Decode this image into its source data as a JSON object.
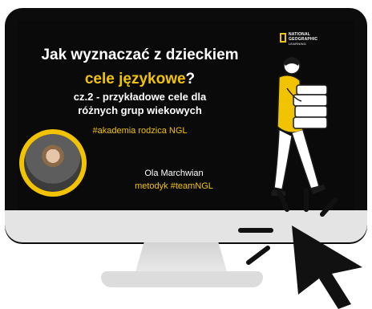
{
  "slide": {
    "title_line1": "Jak wyznaczać z dzieckiem",
    "title_line2_highlight": "cele językowe",
    "title_line2_tail": "?",
    "subtitle_line1": "cz.2 - przykładowe cele dla",
    "subtitle_line2": "różnych grup wiekowych",
    "hashtag": "#akademia rodzica NGL",
    "presenter_name": "Ola Marchwian",
    "presenter_role": "metodyk #teamNGL"
  },
  "logo": {
    "line1": "NATIONAL",
    "line2": "GEOGRAPHIC",
    "line3": "LEARNING"
  },
  "colors": {
    "accent": "#f2c300",
    "screen_bg": "#0a0a0a",
    "monitor_frame": "#0c0c0c",
    "monitor_chin": "#e4e4e4"
  },
  "icons": [
    "mouse-cursor-icon",
    "click-burst-icon"
  ]
}
